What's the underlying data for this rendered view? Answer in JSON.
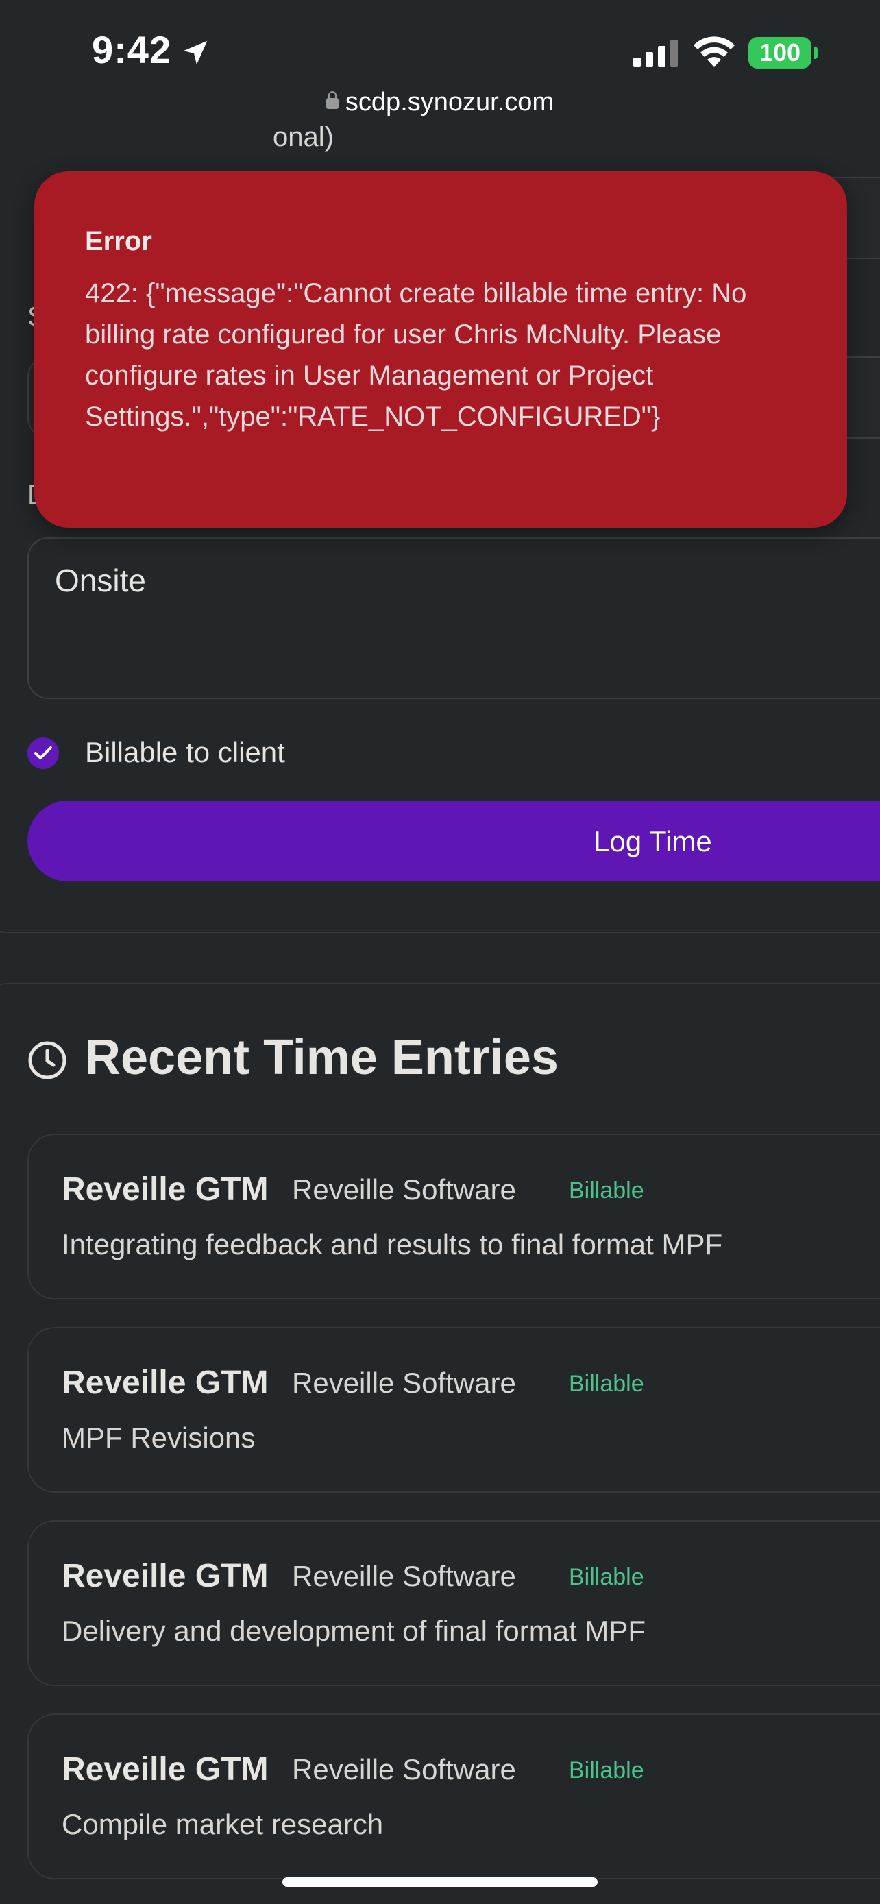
{
  "status_bar": {
    "time": "9:42",
    "battery": "100",
    "url": "scdp.synozur.com"
  },
  "form": {
    "partial_label": "onal)",
    "description_value": "Onsite",
    "billable_label": "Billable to client",
    "billable_checked": true,
    "submit_label": "Log Time"
  },
  "toast": {
    "title": "Error",
    "message": "422: {\"message\":\"Cannot create billable time entry: No billing rate configured for user Chris McNulty. Please configure rates in User Management or Project Settings.\",\"type\":\"RATE_NOT_CONFIGURED\"}"
  },
  "recent": {
    "title": "Recent Time Entries",
    "entries": [
      {
        "project": "Reveille GTM",
        "client": "Reveille Software",
        "badge": "Billable",
        "description": "Integrating feedback and results to final format MPF"
      },
      {
        "project": "Reveille GTM",
        "client": "Reveille Software",
        "badge": "Billable",
        "description": "MPF Revisions"
      },
      {
        "project": "Reveille GTM",
        "client": "Reveille Software",
        "badge": "Billable",
        "description": "Delivery and development of final format MPF"
      },
      {
        "project": "Reveille GTM",
        "client": "Reveille Software",
        "badge": "Billable",
        "description": "Compile market research"
      }
    ]
  },
  "colors": {
    "background": "#24272a",
    "accent_purple": "#6015b5",
    "error_red": "#a81b25",
    "billable_green": "#4cc38a",
    "battery_green": "#34c759"
  }
}
